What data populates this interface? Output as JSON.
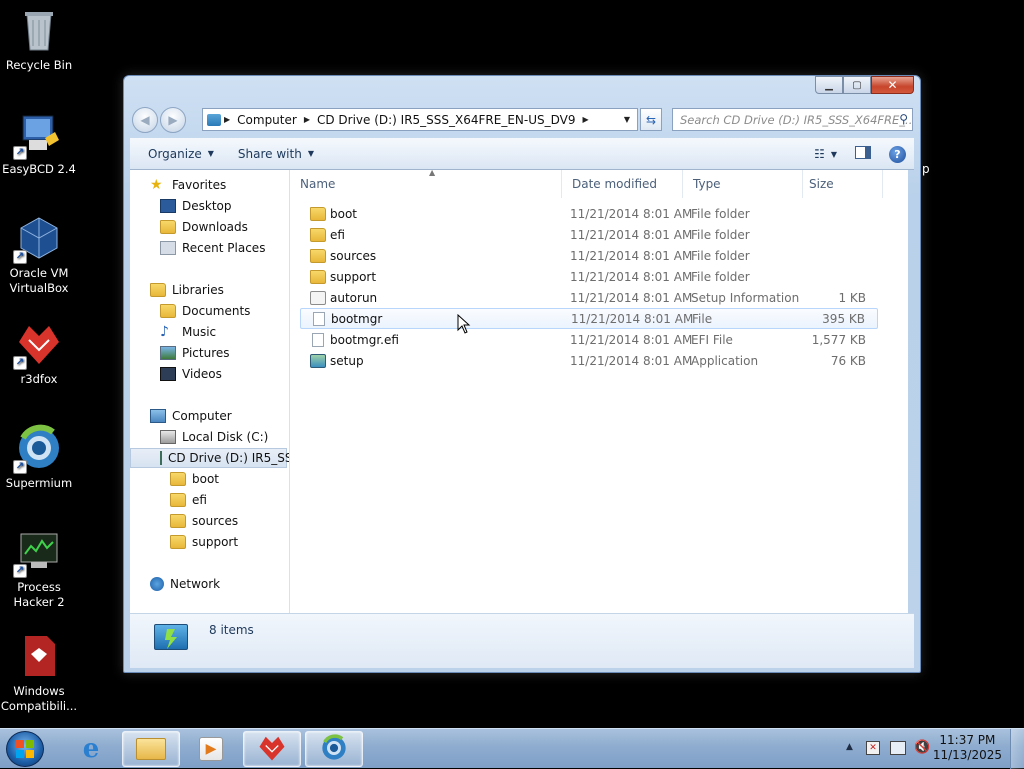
{
  "desktop": {
    "icons": [
      {
        "label": "Recycle Bin",
        "icon": "recycle-bin-icon"
      },
      {
        "label": "EasyBCD 2.4",
        "icon": "easybcd-icon"
      },
      {
        "label": "Oracle VM\nVirtualBox",
        "icon": "virtualbox-icon"
      },
      {
        "label": "r3dfox",
        "icon": "r3dfox-icon"
      },
      {
        "label": "Supermium",
        "icon": "supermium-icon"
      },
      {
        "label": "Process\nHacker 2",
        "icon": "process-hacker-icon"
      },
      {
        "label": "Windows\nCompatibili...",
        "icon": "windows-compat-icon"
      }
    ],
    "stray_text": "p"
  },
  "window": {
    "caption_buttons": {
      "minimize": "minimize-icon",
      "maximize": "maximize-icon",
      "close": "close-icon"
    },
    "address": {
      "crumbs": [
        "Computer",
        "CD Drive (D:) IR5_SSS_X64FRE_EN-US_DV9"
      ]
    },
    "search": {
      "placeholder": "Search CD Drive (D:) IR5_SSS_X64FRE_..."
    },
    "toolbar": {
      "organize": "Organize",
      "share_with": "Share with"
    },
    "navpane": {
      "favorites": "Favorites",
      "desktop": "Desktop",
      "downloads": "Downloads",
      "recent_places": "Recent Places",
      "libraries": "Libraries",
      "documents": "Documents",
      "music": "Music",
      "pictures": "Pictures",
      "videos": "Videos",
      "computer": "Computer",
      "local_disk": "Local Disk (C:)",
      "cd_drive": "CD Drive (D:) IR5_SSS",
      "boot": "boot",
      "efi": "efi",
      "sources": "sources",
      "support": "support",
      "network": "Network"
    },
    "columns": {
      "name": "Name",
      "date": "Date modified",
      "type": "Type",
      "size": "Size"
    },
    "files": [
      {
        "name": "boot",
        "date": "11/21/2014 8:01 AM",
        "type": "File folder",
        "size": "",
        "icon": "folder-icon"
      },
      {
        "name": "efi",
        "date": "11/21/2014 8:01 AM",
        "type": "File folder",
        "size": "",
        "icon": "folder-icon"
      },
      {
        "name": "sources",
        "date": "11/21/2014 8:01 AM",
        "type": "File folder",
        "size": "",
        "icon": "folder-icon"
      },
      {
        "name": "support",
        "date": "11/21/2014 8:01 AM",
        "type": "File folder",
        "size": "",
        "icon": "folder-icon"
      },
      {
        "name": "autorun",
        "date": "11/21/2014 8:01 AM",
        "type": "Setup Information",
        "size": "1 KB",
        "icon": "setup-info-icon"
      },
      {
        "name": "bootmgr",
        "date": "11/21/2014 8:01 AM",
        "type": "File",
        "size": "395 KB",
        "icon": "file-icon"
      },
      {
        "name": "bootmgr.efi",
        "date": "11/21/2014 8:01 AM",
        "type": "EFI File",
        "size": "1,577 KB",
        "icon": "file-icon"
      },
      {
        "name": "setup",
        "date": "11/21/2014 8:01 AM",
        "type": "Application",
        "size": "76 KB",
        "icon": "application-icon"
      }
    ],
    "details": {
      "count": "8 items"
    }
  },
  "taskbar": {
    "clock_time": "11:37 PM",
    "clock_date": "11/13/2025"
  }
}
